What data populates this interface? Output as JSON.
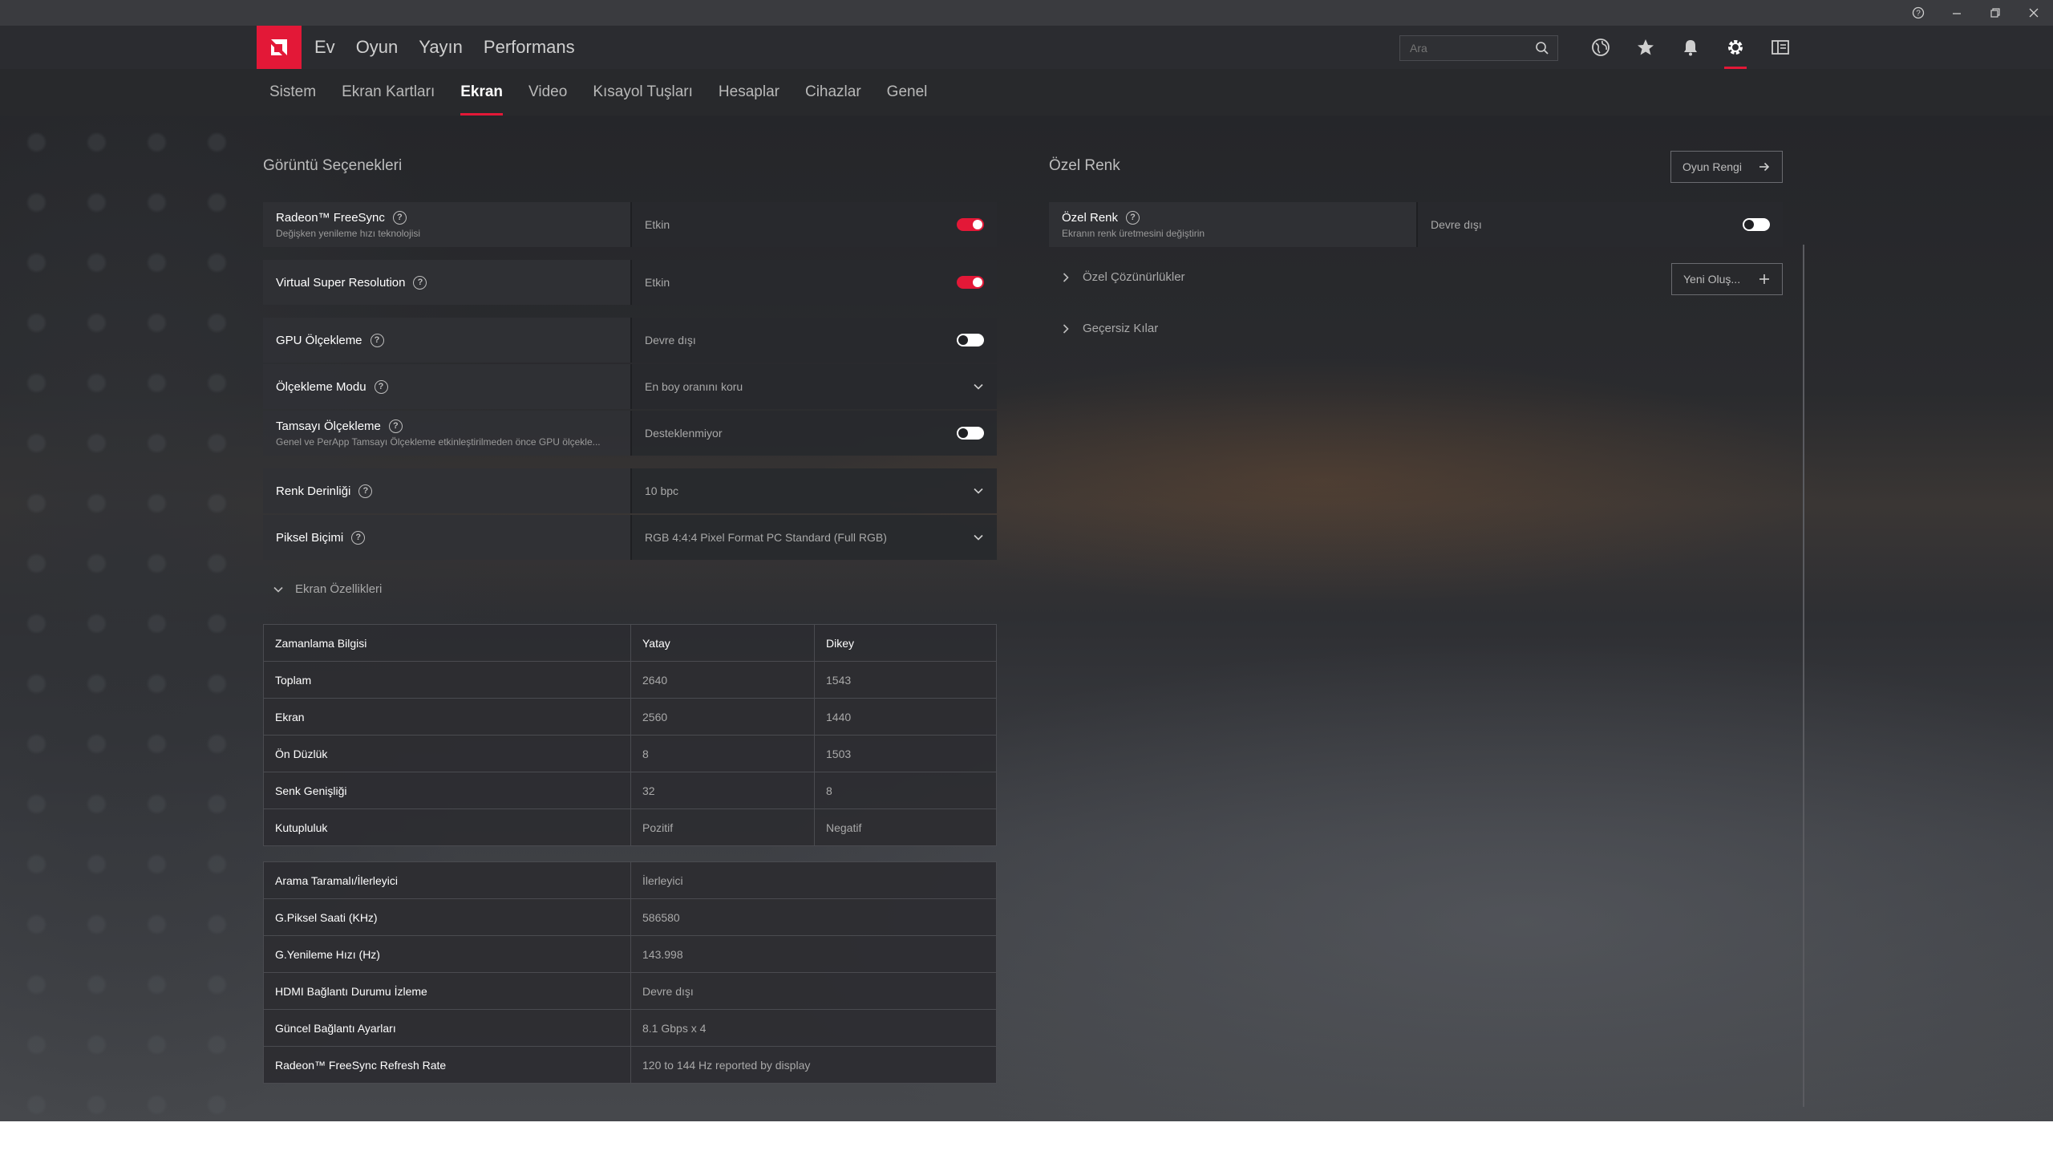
{
  "titlebar": {
    "help": "?",
    "minimize": "–",
    "restore": "❐",
    "close": "✕"
  },
  "header": {
    "nav": [
      "Ev",
      "Oyun",
      "Yayın",
      "Performans"
    ],
    "search_placeholder": "Ara"
  },
  "subnav": {
    "tabs": [
      "Sistem",
      "Ekran Kartları",
      "Ekran",
      "Video",
      "Kısayol Tuşları",
      "Hesaplar",
      "Cihazlar",
      "Genel"
    ],
    "active": "Ekran"
  },
  "display_options": {
    "title": "Görüntü Seçenekleri",
    "freesync": {
      "label": "Radeon™ FreeSync",
      "desc": "Değişken yenileme hızı teknolojisi",
      "value": "Etkin",
      "on": true
    },
    "vsr": {
      "label": "Virtual Super Resolution",
      "value": "Etkin",
      "on": true
    },
    "gpu_scaling": {
      "label": "GPU Ölçekleme",
      "value": "Devre dışı",
      "on": false
    },
    "scaling_mode": {
      "label": "Ölçekleme Modu",
      "value": "En boy oranını koru"
    },
    "integer_scaling": {
      "label": "Tamsayı Ölçekleme",
      "desc": "Genel ve PerApp Tamsayı Ölçekleme etkinleştirilmeden önce GPU ölçekle...",
      "value": "Desteklenmiyor",
      "on": false
    },
    "color_depth": {
      "label": "Renk Derinliği",
      "value": "10 bpc"
    },
    "pixel_format": {
      "label": "Piksel Biçimi",
      "value": "RGB 4:4:4 Pixel Format PC Standard (Full RGB)"
    }
  },
  "display_specs": {
    "title": "Ekran Özellikleri",
    "timing": {
      "headers": [
        "Zamanlama Bilgisi",
        "Yatay",
        "Dikey"
      ],
      "rows": [
        [
          "Toplam",
          "2640",
          "1543"
        ],
        [
          "Ekran",
          "2560",
          "1440"
        ],
        [
          "Ön Düzlük",
          "8",
          "1503"
        ],
        [
          "Senk Genişliği",
          "32",
          "8"
        ],
        [
          "Kutupluluk",
          "Pozitif",
          "Negatif"
        ]
      ]
    },
    "info": [
      [
        "Arama Taramalı/İlerleyici",
        "İlerleyici"
      ],
      [
        "G.Piksel Saati (KHz)",
        "586580"
      ],
      [
        "G.Yenileme Hızı (Hz)",
        "143.998"
      ],
      [
        "HDMI Bağlantı Durumu İzleme",
        "Devre dışı"
      ],
      [
        "Güncel Bağlantı Ayarları",
        "8.1 Gbps x 4"
      ],
      [
        "Radeon™ FreeSync Refresh Rate",
        "120 to 144 Hz reported by display"
      ]
    ]
  },
  "custom_color": {
    "title": "Özel Renk",
    "game_color_button": "Oyun Rengi",
    "setting": {
      "label": "Özel Renk",
      "desc": "Ekranın renk üretmesini değiştirin",
      "value": "Devre dışı",
      "on": false
    },
    "custom_resolutions": "Özel Çözünürlükler",
    "new_button": "Yeni Oluş...",
    "overrides": "Geçersiz Kılar"
  },
  "colors": {
    "accent": "#e31837"
  }
}
